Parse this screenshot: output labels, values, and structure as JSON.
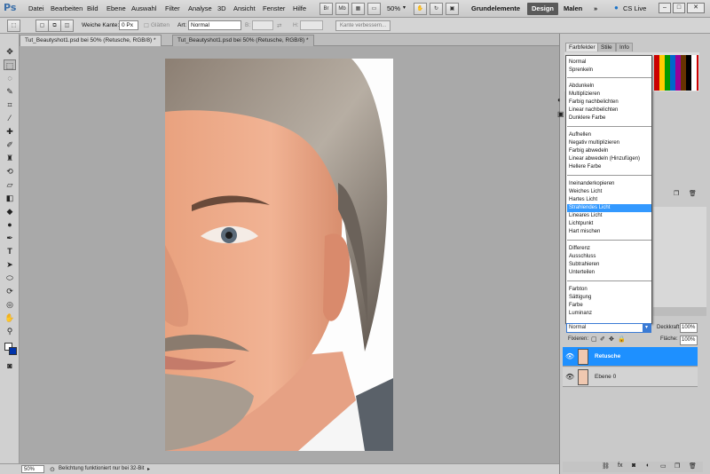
{
  "menubar": {
    "logo": "Ps",
    "items": [
      "Datei",
      "Bearbeiten",
      "Bild",
      "Ebene",
      "Auswahl",
      "Filter",
      "Analyse",
      "3D",
      "Ansicht",
      "Fenster",
      "Hilfe"
    ],
    "zoom": "50%",
    "workspaces": [
      "Grundelemente",
      "Design",
      "Malen"
    ],
    "active_workspace": "Design",
    "overflow": "»",
    "cs_live": "CS Live"
  },
  "options": {
    "feather_label": "Weiche Kante:",
    "feather_value": "0 Px",
    "smooth_label": "Glätten",
    "style_label": "Art:",
    "style_value": "Normal",
    "width_label": "B:",
    "height_label": "H:",
    "refine_button": "Kante verbessern..."
  },
  "tabs": [
    {
      "label": "Tut_Beautyshot1.psd bei 50% (Retusche, RGB/8) *",
      "active": true
    },
    {
      "label": "Tut_Beautyshot1.psd bei 50% (Retusche, RGB/8) *",
      "active": false
    }
  ],
  "status": {
    "zoom": "50%",
    "message": "Belichtung funktioniert nur bei 32-Bit"
  },
  "panel": {
    "tabs": [
      "Farbfelder",
      "Stile",
      "Info"
    ],
    "swatch_colors": [
      "#ff0000",
      "#ffff00",
      "#00ff00",
      "#00ffff",
      "#0000ff",
      "#ff00ff",
      "#ffffff",
      "#000000",
      "#808080",
      "#ff8000",
      "#008000",
      "#800080"
    ]
  },
  "blend_modes": {
    "groups": [
      [
        "Normal",
        "Sprenkeln"
      ],
      [
        "Abdunkeln",
        "Multiplizieren",
        "Farbig nachbelichten",
        "Linear nachbelichten",
        "Dunklere Farbe"
      ],
      [
        "Aufhellen",
        "Negativ multiplizieren",
        "Farbig abwedeln",
        "Linear abwedeln (Hinzufügen)",
        "Hellere Farbe"
      ],
      [
        "Ineinanderkopieren",
        "Weiches Licht",
        "Hartes Licht",
        "Strahlendes Licht",
        "Lineares Licht",
        "Lichtpunkt",
        "Hart mischen"
      ],
      [
        "Differenz",
        "Ausschluss",
        "Subtrahieren",
        "Unterteilen"
      ],
      [
        "Farbton",
        "Sättigung",
        "Farbe",
        "Luminanz"
      ]
    ],
    "selected": "Strahlendes Licht"
  },
  "layers": {
    "blend_value": "Normal",
    "opacity_label": "Deckkraft:",
    "opacity_value": "100%",
    "lock_label": "Fixieren:",
    "fill_label": "Fläche:",
    "fill_value": "100%",
    "items": [
      {
        "name": "Retusche",
        "selected": true
      },
      {
        "name": "Ebene 0",
        "selected": false
      }
    ]
  }
}
